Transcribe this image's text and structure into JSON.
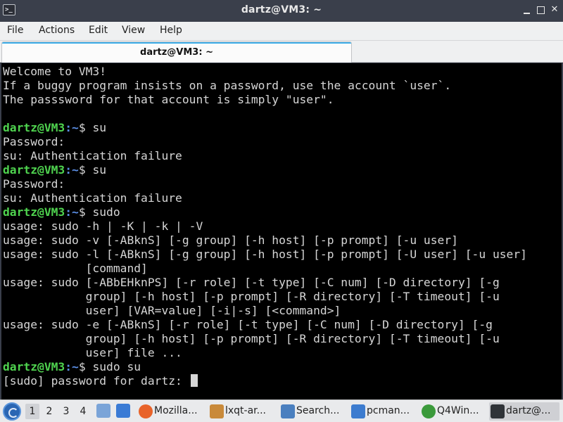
{
  "window": {
    "title": "dartz@VM3: ~",
    "app_icon": "terminal-icon",
    "controls": {
      "minimize": "minimize-icon",
      "maximize": "maximize-icon",
      "close_glyph": "✕"
    }
  },
  "menubar": {
    "items": [
      "File",
      "Actions",
      "Edit",
      "View",
      "Help"
    ]
  },
  "tabs": [
    {
      "label": "dartz@VM3: ~",
      "active": true
    }
  ],
  "terminal": {
    "prompt_user": "dartz@VM3",
    "prompt_path": ":~",
    "prompt_symbol": "$ ",
    "lines": [
      {
        "text": "Welcome to VM3!"
      },
      {
        "text": "If a buggy program insists on a password, use the account `user`."
      },
      {
        "text": "The passsword for that account is simply \"user\"."
      },
      {
        "text": ""
      },
      {
        "prompt": true,
        "command": "su"
      },
      {
        "text": "Password:"
      },
      {
        "text": "su: Authentication failure"
      },
      {
        "prompt": true,
        "command": "su"
      },
      {
        "text": "Password:"
      },
      {
        "text": "su: Authentication failure"
      },
      {
        "prompt": true,
        "command": "sudo"
      },
      {
        "text": "usage: sudo -h | -K | -k | -V"
      },
      {
        "text": "usage: sudo -v [-ABknS] [-g group] [-h host] [-p prompt] [-u user]"
      },
      {
        "text": "usage: sudo -l [-ABknS] [-g group] [-h host] [-p prompt] [-U user] [-u user]"
      },
      {
        "text": "            [command]"
      },
      {
        "text": "usage: sudo [-ABbEHknPS] [-r role] [-t type] [-C num] [-D directory] [-g"
      },
      {
        "text": "            group] [-h host] [-p prompt] [-R directory] [-T timeout] [-u"
      },
      {
        "text": "            user] [VAR=value] [-i|-s] [<command>]"
      },
      {
        "text": "usage: sudo -e [-ABknS] [-r role] [-t type] [-C num] [-D directory] [-g"
      },
      {
        "text": "            group] [-h host] [-p prompt] [-R directory] [-T timeout] [-u"
      },
      {
        "text": "            user] file ..."
      },
      {
        "prompt": true,
        "command": "sudo su"
      },
      {
        "text": "[sudo] password for dartz: ",
        "cursor": true
      }
    ]
  },
  "taskbar": {
    "start_icon": "lxqt-start-icon",
    "workspaces": [
      {
        "label": "1",
        "active": true
      },
      {
        "label": "2",
        "active": false
      },
      {
        "label": "3",
        "active": false
      },
      {
        "label": "4",
        "active": false
      }
    ],
    "quicklaunch": [
      {
        "icon": "file-manager-icon",
        "color": "#7aa4d8"
      },
      {
        "icon": "desktop-icon",
        "color": "#3a7bd5"
      }
    ],
    "tasks": [
      {
        "label": "Mozilla...",
        "icon": "firefox-icon",
        "color": "#e8632a",
        "active": false
      },
      {
        "label": "lxqt-ar...",
        "icon": "archiver-icon",
        "color": "#c98a3a",
        "active": false
      },
      {
        "label": "Search...",
        "icon": "search-icon",
        "color": "#4a7fbf",
        "active": false
      },
      {
        "label": "pcman...",
        "icon": "folder-icon",
        "color": "#3d7ccf",
        "active": false
      },
      {
        "label": "Q4Win...",
        "icon": "wine-icon",
        "color": "#3b9a3b",
        "active": false
      },
      {
        "label": "dartz@...",
        "icon": "terminal-icon",
        "color": "#2f3338",
        "active": true
      }
    ]
  }
}
